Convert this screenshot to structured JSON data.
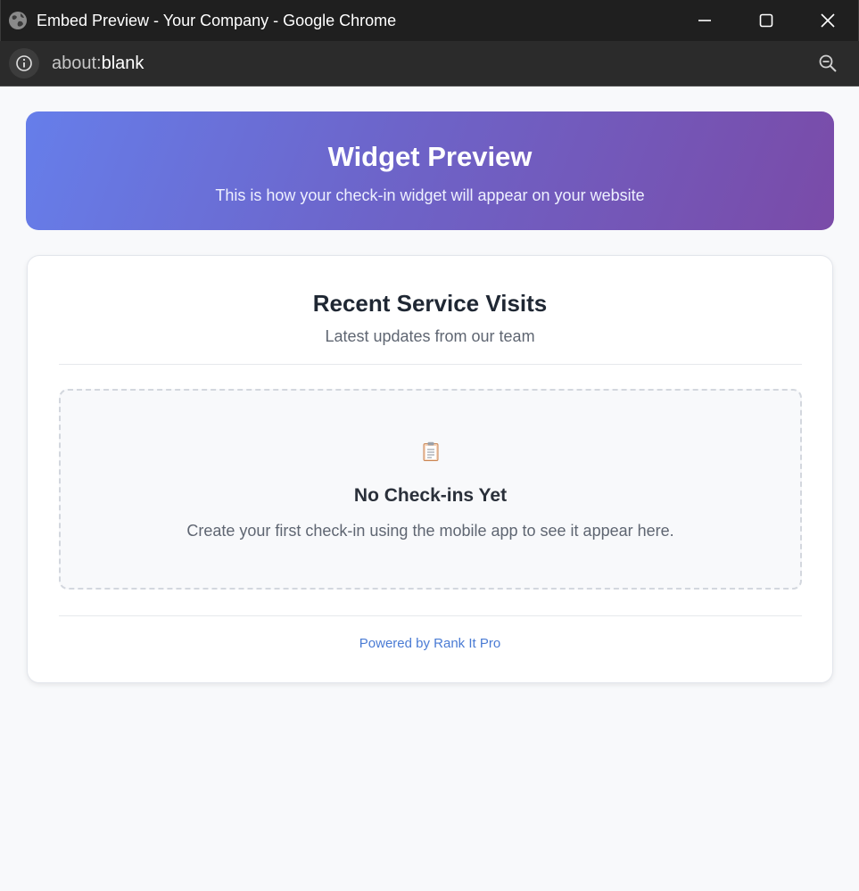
{
  "window": {
    "title": "Embed Preview - Your Company - Google Chrome"
  },
  "addressbar": {
    "url_scheme": "about:",
    "url_host": "blank"
  },
  "hero": {
    "title": "Widget Preview",
    "subtitle": "This is how your check-in widget will appear on your website"
  },
  "widget": {
    "title": "Recent Service Visits",
    "subtitle": "Latest updates from our team",
    "empty_state": {
      "icon": "clipboard-icon",
      "title": "No Check-ins Yet",
      "text": "Create your first check-in using the mobile app to see it appear here."
    },
    "footer_link": "Powered by Rank It Pro"
  },
  "colors": {
    "gradient_start": "#667eea",
    "gradient_end": "#7a4ba8",
    "link": "#4a7bd4"
  }
}
